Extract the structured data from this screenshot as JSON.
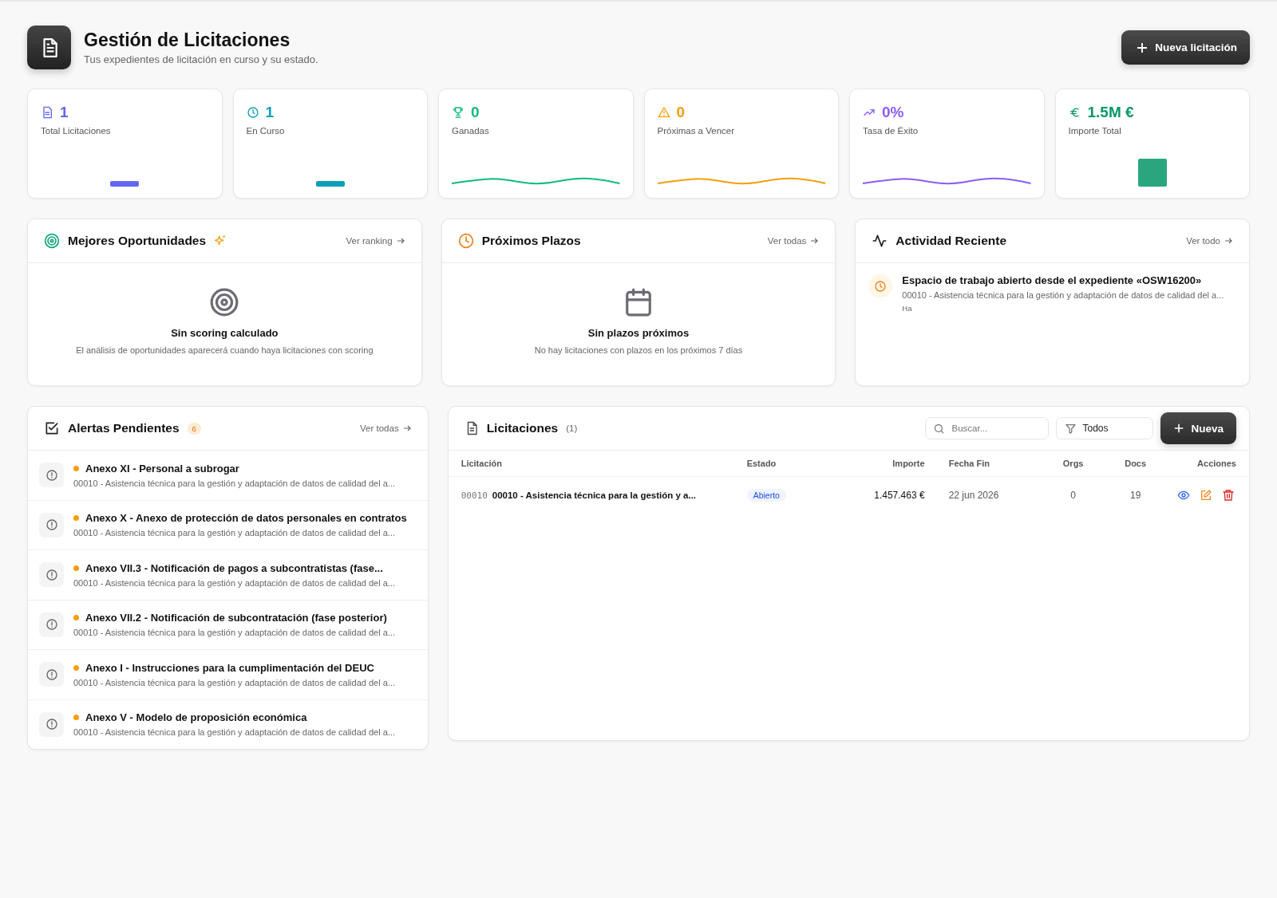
{
  "header": {
    "title": "Gestión de Licitaciones",
    "subtitle": "Tus expedientes de licitación en curso y su estado.",
    "new_button": "Nueva licitación"
  },
  "stats": [
    {
      "value": "1",
      "label": "Total Licitaciones",
      "color": "#6366f1"
    },
    {
      "value": "1",
      "label": "En Curso",
      "color": "#0e9fb8"
    },
    {
      "value": "0",
      "label": "Ganadas",
      "color": "#10b981"
    },
    {
      "value": "0",
      "label": "Próximas a Vencer",
      "color": "#f59e0b"
    },
    {
      "value": "0%",
      "label": "Tasa de Éxito",
      "color": "#8b5cf6"
    },
    {
      "value": "1.5M €",
      "label": "Importe Total",
      "color": "#059669"
    }
  ],
  "opportunities": {
    "title": "Mejores Oportunidades",
    "link": "Ver ranking",
    "empty_title": "Sin scoring calculado",
    "empty_text": "El análisis de oportunidades aparecerá cuando haya licitaciones con scoring"
  },
  "deadlines": {
    "title": "Próximos Plazos",
    "link": "Ver todas",
    "empty_title": "Sin plazos próximos",
    "empty_text": "No hay licitaciones con plazos en los próximos 7 días"
  },
  "activity": {
    "title": "Actividad Reciente",
    "link": "Ver todo",
    "items": [
      {
        "title": "Espacio de trabajo abierto desde el expediente «OSW16200»",
        "subtitle": "00010 - Asistencia técnica para la gestión y adaptación de datos de calidad del a...",
        "time": "Ha"
      }
    ]
  },
  "alerts": {
    "title": "Alertas Pendientes",
    "count": "6",
    "link": "Ver todas",
    "items": [
      {
        "title": "Anexo XI - Personal a subrogar",
        "subtitle": "00010 - Asistencia técnica para la gestión y adaptación de datos de calidad del a...",
        "color": "#f59e0b"
      },
      {
        "title": "Anexo X - Anexo de protección de datos personales en contratos",
        "subtitle": "00010 - Asistencia técnica para la gestión y adaptación de datos de calidad del a...",
        "color": "#f59e0b"
      },
      {
        "title": "Anexo VII.3 - Notificación de pagos a subcontratistas (fase...",
        "subtitle": "00010 - Asistencia técnica para la gestión y adaptación de datos de calidad del a...",
        "color": "#f59e0b"
      },
      {
        "title": "Anexo VII.2 - Notificación de subcontratación (fase posterior)",
        "subtitle": "00010 - Asistencia técnica para la gestión y adaptación de datos de calidad del a...",
        "color": "#f59e0b"
      },
      {
        "title": "Anexo I - Instrucciones para la cumplimentación del DEUC",
        "subtitle": "00010 - Asistencia técnica para la gestión y adaptación de datos de calidad del a...",
        "color": "#f59e0b"
      },
      {
        "title": "Anexo V - Modelo de proposición económica",
        "subtitle": "00010 - Asistencia técnica para la gestión y adaptación de datos de calidad del a...",
        "color": "#f59e0b"
      }
    ]
  },
  "tenders": {
    "title": "Licitaciones",
    "count": "(1)",
    "search": {
      "placeholder": "Buscar..."
    },
    "filter": "Todos",
    "new_button": "Nueva",
    "columns": [
      "Licitación",
      "Estado",
      "Importe",
      "Fecha Fin",
      "Orgs",
      "Docs",
      "Acciones"
    ],
    "rows": [
      {
        "code": "00010",
        "title": "00010 - Asistencia técnica para la gestión y a...",
        "status": "Abierto",
        "amount": "1.457.463 €",
        "end_date": "22 jun 2026",
        "orgs": "0",
        "docs": "19"
      }
    ]
  }
}
